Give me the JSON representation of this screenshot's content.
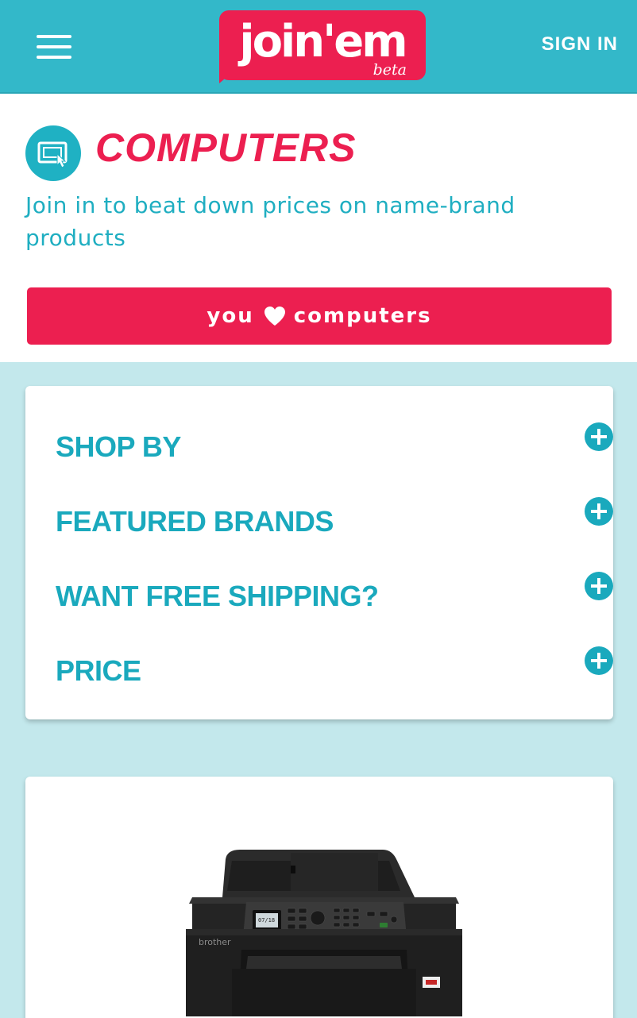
{
  "header": {
    "logo_text": "join'em",
    "logo_badge": "beta",
    "sign_in_label": "SIGN IN",
    "menu_icon": "hamburger-menu-icon"
  },
  "category": {
    "icon": "touchscreen-computer-icon",
    "title": "COMPUTERS",
    "subtitle": "Join in to beat down prices on name-brand products",
    "love_button": {
      "prefix": "you",
      "icon": "heart-icon",
      "suffix": "computers"
    }
  },
  "filters": [
    {
      "label": "SHOP BY",
      "icon": "plus-circle-icon"
    },
    {
      "label": "FEATURED BRANDS",
      "icon": "plus-circle-icon"
    },
    {
      "label": "WANT FREE SHIPPING?",
      "icon": "plus-circle-icon"
    },
    {
      "label": "PRICE",
      "icon": "plus-circle-icon"
    }
  ],
  "product": {
    "image": "printer-image",
    "brand_text": "brother",
    "screen_text": "07/18"
  },
  "colors": {
    "header_bg": "#33b8c9",
    "accent_pink": "#ec1f50",
    "accent_teal": "#1aa9bd",
    "page_bg": "#c3e8ec"
  }
}
